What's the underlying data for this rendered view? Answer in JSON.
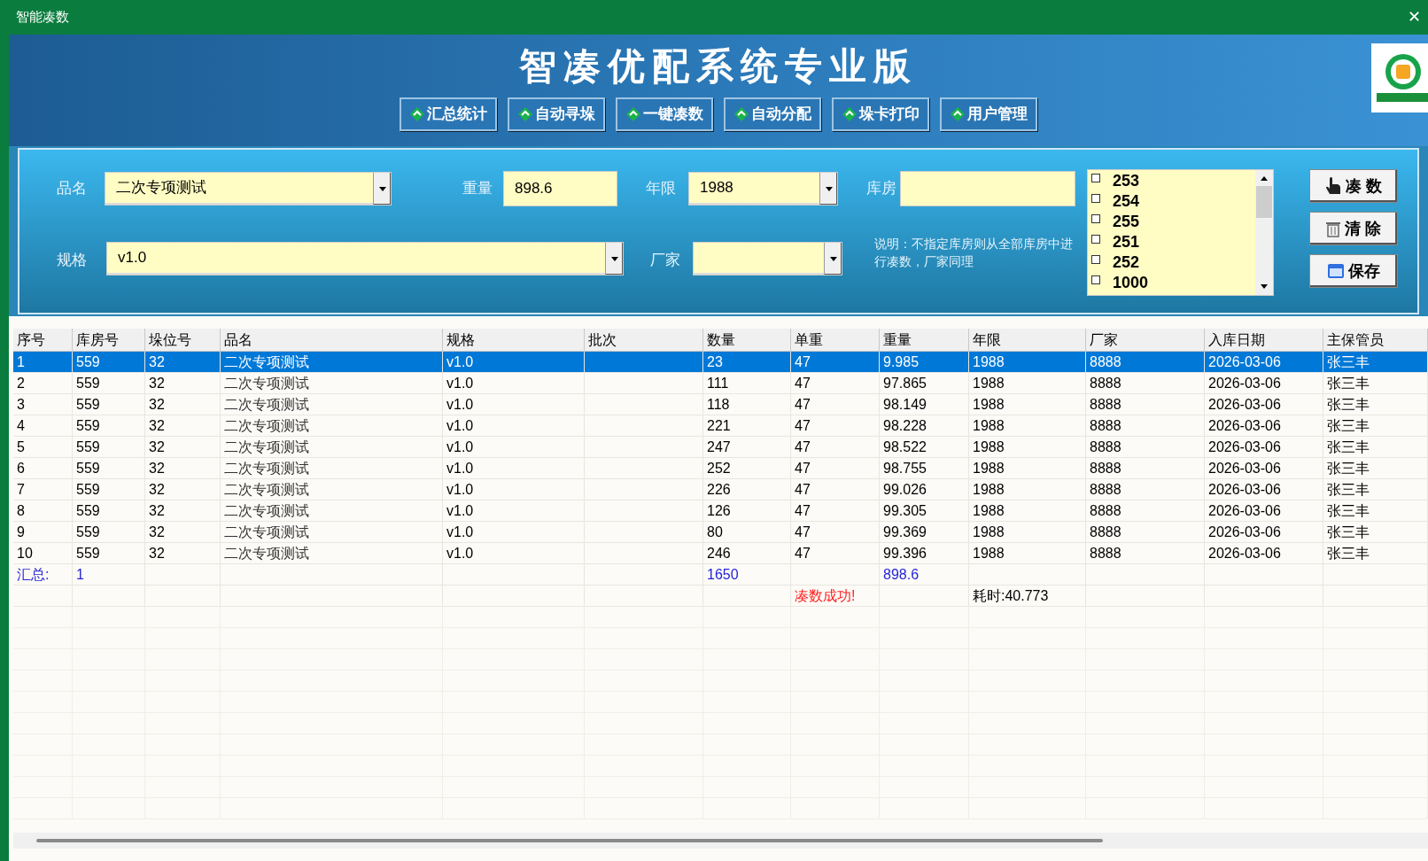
{
  "window": {
    "title": "智能凑数",
    "close": "✕"
  },
  "header": {
    "title": "智凑优配系统专业版"
  },
  "toolbar": [
    "汇总统计",
    "自动寻垛",
    "一键凑数",
    "自动分配",
    "垛卡打印",
    "用户管理"
  ],
  "form": {
    "product": {
      "label": "品名",
      "value": "二次专项测试"
    },
    "weight": {
      "label": "重量",
      "value": "898.6"
    },
    "year": {
      "label": "年限",
      "value": "1988"
    },
    "warehouse": {
      "label": "库房"
    },
    "spec": {
      "label": "规格",
      "value": "v1.0"
    },
    "maker": {
      "label": "厂家"
    },
    "note": "说明：不指定库房则从全部库房中进行凑数，厂家同理",
    "warehouse_list": [
      {
        "label": "253",
        "checked": false
      },
      {
        "label": "254",
        "checked": false
      },
      {
        "label": "255",
        "checked": false
      },
      {
        "label": "251",
        "checked": false
      },
      {
        "label": "252",
        "checked": false
      },
      {
        "label": "1000",
        "checked": false
      }
    ],
    "buttons": [
      {
        "kind": "hand",
        "label": "凑 数"
      },
      {
        "kind": "trash",
        "label": "清 除"
      },
      {
        "kind": "save",
        "label": "保存"
      }
    ]
  },
  "table": {
    "columns": [
      "序号",
      "库房号",
      "垛位号",
      "品名",
      "规格",
      "批次",
      "数量",
      "单重",
      "重量",
      "年限",
      "厂家",
      "入库日期",
      "主保管员"
    ],
    "rows": [
      {
        "selected": true,
        "cells": [
          "1",
          "559",
          "32",
          "二次专项测试",
          "v1.0",
          "",
          "23",
          "47",
          "9.985",
          "1988",
          "8888",
          "2026-03-06",
          "张三丰"
        ]
      },
      {
        "selected": false,
        "cells": [
          "2",
          "559",
          "32",
          "二次专项测试",
          "v1.0",
          "",
          "111",
          "47",
          "97.865",
          "1988",
          "8888",
          "2026-03-06",
          "张三丰"
        ]
      },
      {
        "selected": false,
        "cells": [
          "3",
          "559",
          "32",
          "二次专项测试",
          "v1.0",
          "",
          "118",
          "47",
          "98.149",
          "1988",
          "8888",
          "2026-03-06",
          "张三丰"
        ]
      },
      {
        "selected": false,
        "cells": [
          "4",
          "559",
          "32",
          "二次专项测试",
          "v1.0",
          "",
          "221",
          "47",
          "98.228",
          "1988",
          "8888",
          "2026-03-06",
          "张三丰"
        ]
      },
      {
        "selected": false,
        "cells": [
          "5",
          "559",
          "32",
          "二次专项测试",
          "v1.0",
          "",
          "247",
          "47",
          "98.522",
          "1988",
          "8888",
          "2026-03-06",
          "张三丰"
        ]
      },
      {
        "selected": false,
        "cells": [
          "6",
          "559",
          "32",
          "二次专项测试",
          "v1.0",
          "",
          "252",
          "47",
          "98.755",
          "1988",
          "8888",
          "2026-03-06",
          "张三丰"
        ]
      },
      {
        "selected": false,
        "cells": [
          "7",
          "559",
          "32",
          "二次专项测试",
          "v1.0",
          "",
          "226",
          "47",
          "99.026",
          "1988",
          "8888",
          "2026-03-06",
          "张三丰"
        ]
      },
      {
        "selected": false,
        "cells": [
          "8",
          "559",
          "32",
          "二次专项测试",
          "v1.0",
          "",
          "126",
          "47",
          "99.305",
          "1988",
          "8888",
          "2026-03-06",
          "张三丰"
        ]
      },
      {
        "selected": false,
        "cells": [
          "9",
          "559",
          "32",
          "二次专项测试",
          "v1.0",
          "",
          "80",
          "47",
          "99.369",
          "1988",
          "8888",
          "2026-03-06",
          "张三丰"
        ]
      },
      {
        "selected": false,
        "cells": [
          "10",
          "559",
          "32",
          "二次专项测试",
          "v1.0",
          "",
          "246",
          "47",
          "99.396",
          "1988",
          "8888",
          "2026-03-06",
          "张三丰"
        ]
      }
    ],
    "summary": {
      "label": "汇总:",
      "count": "1",
      "quantity": "1650",
      "weight": "898.6"
    },
    "status": {
      "message": "凑数成功!",
      "elapsed": "耗时:40.773"
    }
  }
}
